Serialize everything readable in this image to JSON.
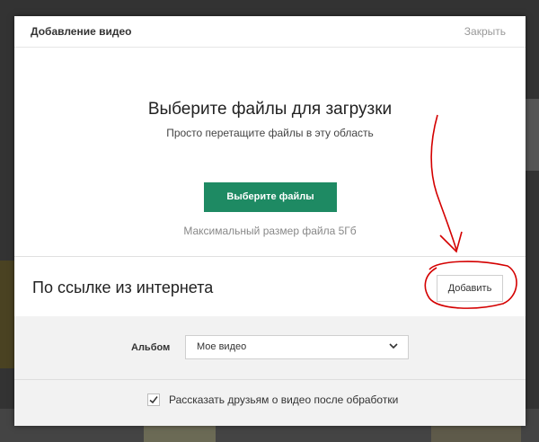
{
  "modal": {
    "title": "Добавление видео",
    "close_label": "Закрыть"
  },
  "upload": {
    "title": "Выберите файлы для загрузки",
    "subtitle": "Просто перетащите файлы в эту область",
    "choose_button_label": "Выберите файлы",
    "max_size_text": "Максимальный размер файла 5Гб",
    "button_color": "#1e8a63"
  },
  "link_section": {
    "title": "По ссылке из интернета",
    "add_button_label": "Добавить"
  },
  "settings": {
    "album_label": "Альбом",
    "album_value": "Мое видео",
    "share_label": "Рассказать друзьям о видео после обработки",
    "share_checked": true
  },
  "annotation_color": "#d40000"
}
